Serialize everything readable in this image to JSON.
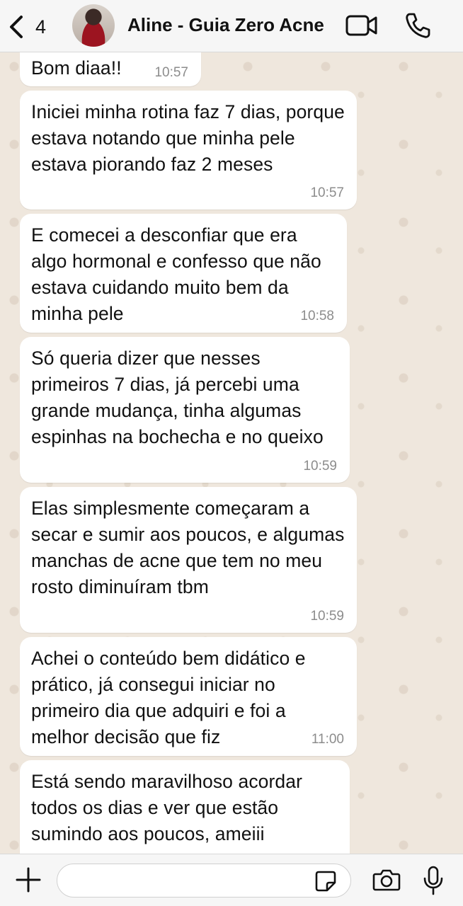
{
  "header": {
    "back_count": "4",
    "contact_name": "Aline - Guia Zero Acne",
    "icons": [
      "chevron-left-icon",
      "video-call-icon",
      "phone-icon"
    ]
  },
  "messages": [
    {
      "text": "Bom diaa!!",
      "time": "10:57"
    },
    {
      "text": "Iniciei minha rotina faz 7 dias, porque estava notando que minha pele estava piorando faz 2 meses",
      "time": "10:57"
    },
    {
      "text": "E comecei a desconfiar que era algo hormonal e confesso que não estava cuidando muito bem da minha pele",
      "time": "10:58"
    },
    {
      "text": "Só queria dizer que nesses primeiros 7 dias, já percebi uma grande mudança, tinha algumas espinhas na bochecha e no queixo",
      "time": "10:59"
    },
    {
      "text": "Elas simplesmente começaram a secar e sumir aos poucos, e algumas manchas de acne que tem no meu rosto diminuíram tbm",
      "time": "10:59"
    },
    {
      "text": "Achei o conteúdo bem didático e prático, já consegui iniciar no primeiro dia que adquiri e foi a melhor decisão que fiz",
      "time": "11:00"
    },
    {
      "text": "Está sendo maravilhoso acordar todos os dias e ver que estão sumindo aos poucos, ameiii",
      "time": ""
    }
  ],
  "composer": {
    "placeholder": "",
    "icons": [
      "plus-icon",
      "sticker-icon",
      "camera-icon",
      "microphone-icon"
    ]
  }
}
